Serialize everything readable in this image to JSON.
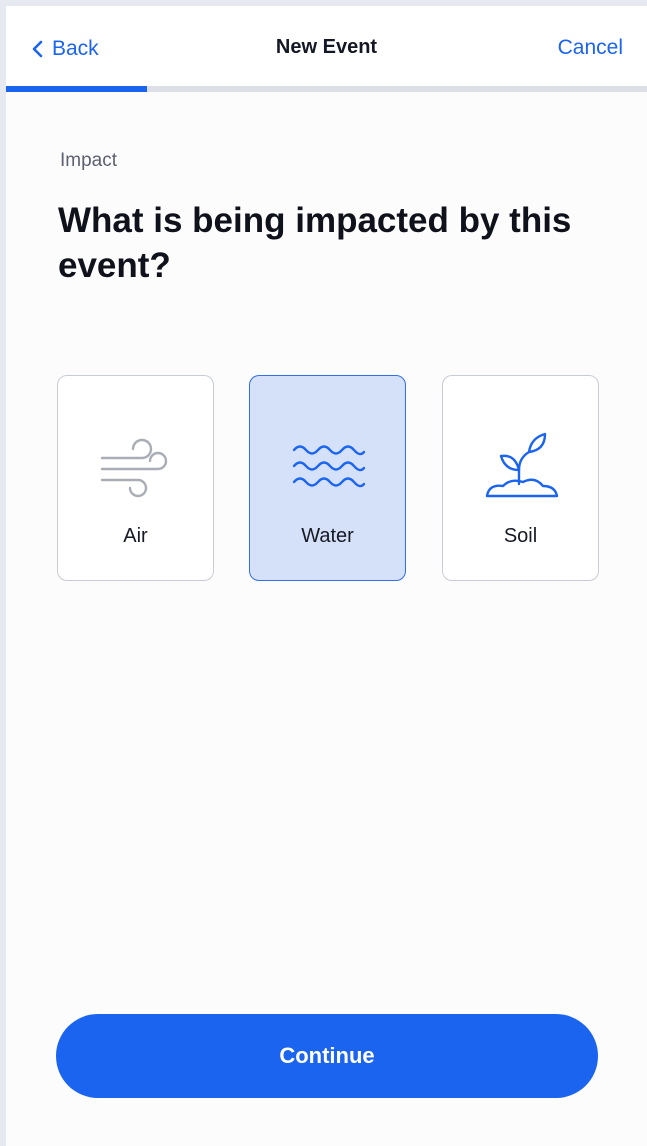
{
  "header": {
    "back_label": "Back",
    "title": "New Event",
    "cancel_label": "Cancel"
  },
  "progress": {
    "fraction": 0.22,
    "color": "#1a64f0"
  },
  "step": {
    "section": "Impact",
    "question": "What is being impacted by this event?"
  },
  "options": [
    {
      "label": "Air",
      "icon": "wind-icon",
      "selected": false
    },
    {
      "label": "Water",
      "icon": "waves-icon",
      "selected": true
    },
    {
      "label": "Soil",
      "icon": "sprout-icon",
      "selected": false
    }
  ],
  "footer": {
    "continue_label": "Continue"
  },
  "colors": {
    "accent": "#1a64f0",
    "selected_bg": "#d5e1f9",
    "air_icon": "#a9adb6"
  }
}
